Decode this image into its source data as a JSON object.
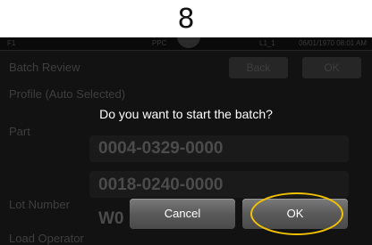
{
  "step": {
    "number": "8"
  },
  "status_bar": {
    "left": "F1",
    "center": "PPC",
    "right": "L1_1",
    "datetime": "06/01/1970 08:01 AM"
  },
  "screen": {
    "title": "Batch Review",
    "back_label": "Back",
    "ok_label": "OK",
    "profile_label": "Profile (Auto Selected)",
    "part_label": "Part",
    "part_value_1": "0004-0329-0000",
    "part_value_2": "0018-0240-0000",
    "lot_number_label": "Lot Number",
    "lot_number_value": "W0",
    "load_operator_label": "Load Operator"
  },
  "dialog": {
    "message": "Do you want to start the batch?",
    "cancel_label": "Cancel",
    "ok_label": "OK"
  },
  "colors": {
    "highlight": "#f2c200"
  }
}
